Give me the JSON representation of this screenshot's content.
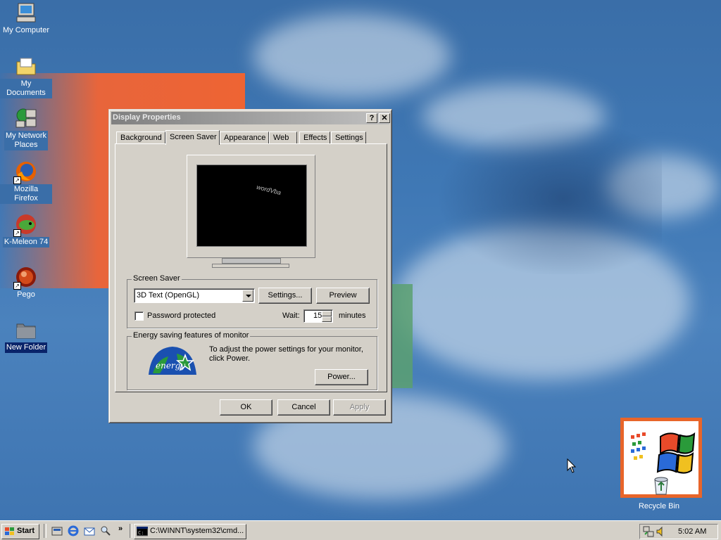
{
  "desktop": {
    "icons": [
      {
        "label": "My Computer",
        "icon": "my-computer-icon"
      },
      {
        "label": "My Documents",
        "icon": "my-documents-icon"
      },
      {
        "label": "My Network\nPlaces",
        "label1": "My Network",
        "label2": "Places",
        "icon": "network-places-icon"
      },
      {
        "label": "Mozilla Firefox",
        "icon": "firefox-icon"
      },
      {
        "label": "K-Meleon 74",
        "icon": "kmeleon-icon"
      },
      {
        "label": "Pego",
        "icon": "pego-icon"
      },
      {
        "label": "New Folder",
        "icon": "folder-icon"
      },
      {
        "label": "Recycle Bin",
        "icon": "recycle-bin-icon"
      }
    ]
  },
  "window": {
    "title": "Display Properties",
    "help_btn": "?",
    "close_btn": "✕",
    "tabs": [
      "Background",
      "Screen Saver",
      "Appearance",
      "Web",
      "Effects",
      "Settings"
    ],
    "active_tab": "Screen Saver",
    "preview_text": "wordVba",
    "screen_saver": {
      "group_label": "Screen Saver",
      "selected": "3D Text (OpenGL)",
      "settings_btn": "Settings...",
      "preview_btn": "Preview",
      "password_label": "Password protected",
      "password_checked": false,
      "wait_label": "Wait:",
      "wait_value": "15",
      "wait_unit": "minutes"
    },
    "energy": {
      "group_label": "Energy saving features of monitor",
      "description": "To adjust the power settings for your monitor, click Power.",
      "power_btn": "Power...",
      "logo_text": "energy"
    },
    "buttons": {
      "ok": "OK",
      "cancel": "Cancel",
      "apply": "Apply"
    }
  },
  "taskbar": {
    "start_label": "Start",
    "quick_launch_more": "»",
    "task_label": "C:\\WINNT\\system32\\cmd...",
    "clock": "5:02 AM"
  },
  "colors": {
    "desktop": "#3a6ea8",
    "face": "#d4d0c8",
    "selection": "#0a246a"
  }
}
